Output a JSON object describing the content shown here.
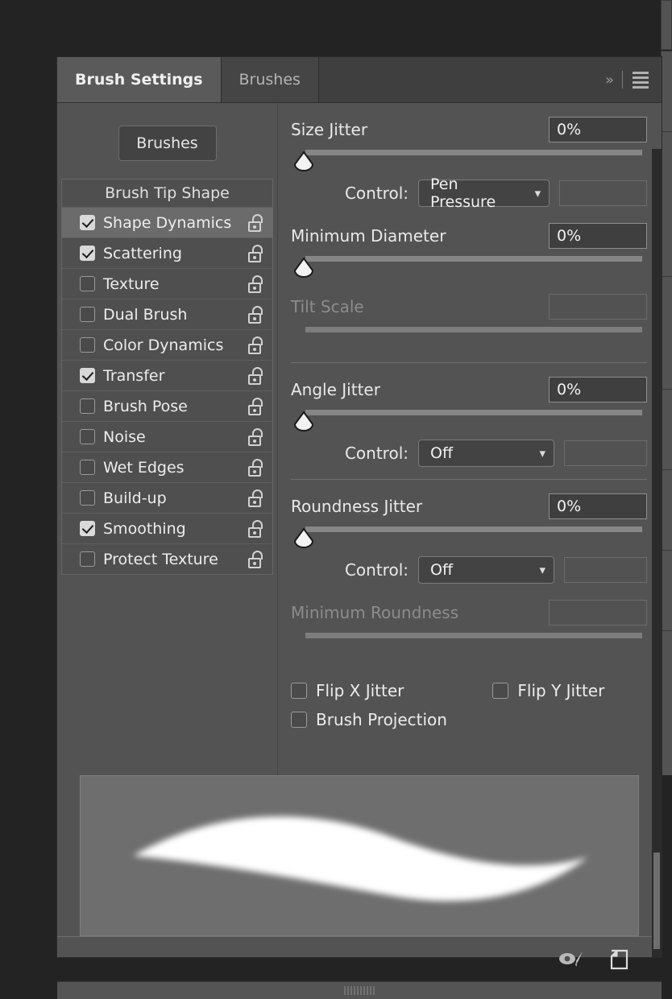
{
  "window": {
    "panel_title": "Brush Settings"
  },
  "tabs": [
    {
      "label": "Brush Settings",
      "active": true
    },
    {
      "label": "Brushes",
      "active": false
    }
  ],
  "header_controls": {
    "collapse_label": "»",
    "menu_label": "menu"
  },
  "left": {
    "brushes_button": "Brushes",
    "list_header": "Brush Tip Shape",
    "items": [
      {
        "label": "Shape Dynamics",
        "checked": true,
        "selected": true,
        "locked": false
      },
      {
        "label": "Scattering",
        "checked": true,
        "selected": false,
        "locked": false
      },
      {
        "label": "Texture",
        "checked": false,
        "selected": false,
        "locked": false
      },
      {
        "label": "Dual Brush",
        "checked": false,
        "selected": false,
        "locked": false
      },
      {
        "label": "Color Dynamics",
        "checked": false,
        "selected": false,
        "locked": false
      },
      {
        "label": "Transfer",
        "checked": true,
        "selected": false,
        "locked": false
      },
      {
        "label": "Brush Pose",
        "checked": false,
        "selected": false,
        "locked": false
      },
      {
        "label": "Noise",
        "checked": false,
        "selected": false,
        "locked": false
      },
      {
        "label": "Wet Edges",
        "checked": false,
        "selected": false,
        "locked": false
      },
      {
        "label": "Build-up",
        "checked": false,
        "selected": false,
        "locked": false
      },
      {
        "label": "Smoothing",
        "checked": true,
        "selected": false,
        "locked": false
      },
      {
        "label": "Protect Texture",
        "checked": false,
        "selected": false,
        "locked": false
      }
    ]
  },
  "settings": {
    "size_jitter": {
      "label": "Size Jitter",
      "value": "0%",
      "slider_percent": 0,
      "control_label": "Control:",
      "control_value": "Pen Pressure",
      "aux_value": ""
    },
    "minimum_diameter": {
      "label": "Minimum Diameter",
      "value": "0%",
      "slider_percent": 0
    },
    "tilt_scale": {
      "label": "Tilt Scale",
      "value": "",
      "disabled": true
    },
    "angle_jitter": {
      "label": "Angle Jitter",
      "value": "0%",
      "slider_percent": 0,
      "control_label": "Control:",
      "control_value": "Off",
      "aux_value": ""
    },
    "roundness_jitter": {
      "label": "Roundness Jitter",
      "value": "0%",
      "slider_percent": 0,
      "control_label": "Control:",
      "control_value": "Off",
      "aux_value": ""
    },
    "minimum_roundness": {
      "label": "Minimum Roundness",
      "value": "",
      "disabled": true
    },
    "flip_x_jitter": {
      "label": "Flip X Jitter",
      "checked": false
    },
    "flip_y_jitter": {
      "label": "Flip Y Jitter",
      "checked": false
    },
    "brush_projection": {
      "label": "Brush Projection",
      "checked": false
    }
  },
  "footer": {
    "toggle_icon": "eye-brush-icon",
    "new_brush_icon": "new-brush-icon"
  },
  "colors": {
    "panel_bg": "#535353",
    "tab_active_bg": "#5a5a5a",
    "tab_inactive_bg": "#454545",
    "text": "#ededed",
    "text_dim": "#8c8c8c",
    "field_bg": "#3f3f3f",
    "track": "#868686",
    "preview_bg": "#6e6e6e",
    "stroke": "#ffffff",
    "selected_row": "#6b6b6b"
  }
}
